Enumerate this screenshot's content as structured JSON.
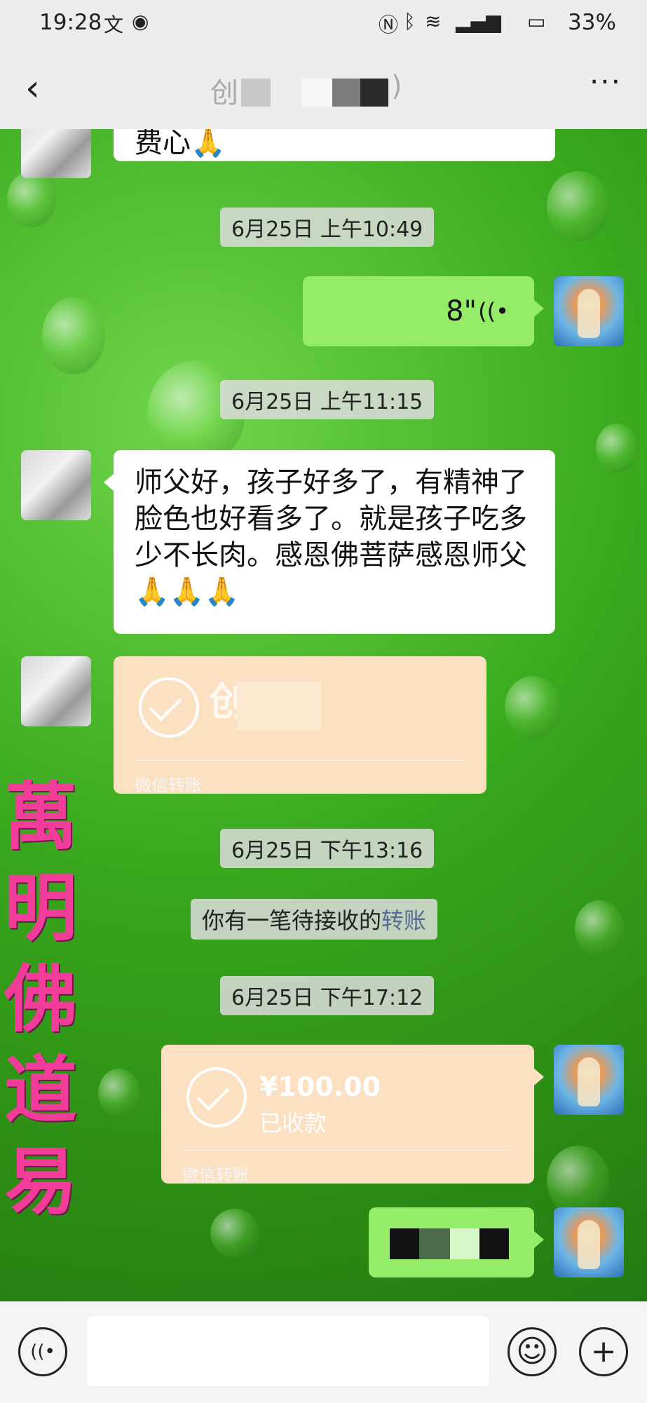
{
  "status_bar": {
    "time": "19:28",
    "battery": "33%",
    "icons": [
      "cn-input-icon",
      "eye-icon",
      "nfc-icon",
      "bluetooth-icon",
      "wifi-icon",
      "signal-icon",
      "battery-icon"
    ]
  },
  "header": {
    "back_glyph": "‹",
    "title_visible": "创",
    "title_suffix": ")",
    "more_glyph": "···"
  },
  "messages": [
    {
      "type": "text",
      "side": "left",
      "text": "费心🙏"
    },
    {
      "type": "time",
      "text": "6月25日 上午10:49"
    },
    {
      "type": "voice",
      "side": "right",
      "duration": "8\"",
      "voice_glyph": "((•"
    },
    {
      "type": "time",
      "text": "6月25日 上午11:15"
    },
    {
      "type": "text",
      "side": "left",
      "text": "师父好，孩子好多了，有精神了脸色也好看多了。就是孩子吃多少不长肉。感恩佛菩萨感恩师父🙏🙏🙏"
    },
    {
      "type": "transfer",
      "side": "left",
      "amount_visible": "创",
      "label": "微信转账"
    },
    {
      "type": "time",
      "text": "6月25日 下午13:16"
    },
    {
      "type": "system",
      "text": "你有一笔待接收的",
      "link": "转账"
    },
    {
      "type": "time",
      "text": "6月25日 下午17:12"
    },
    {
      "type": "transfer",
      "side": "right",
      "amount": "¥100.00",
      "status": "已收款",
      "label": "微信转账"
    },
    {
      "type": "text",
      "side": "right",
      "text": ""
    }
  ],
  "watermark": {
    "text": "萬明佛道易"
  },
  "bottom_bar": {
    "voice_glyph": "((•",
    "emoji_glyph": "☺",
    "plus_glyph": "+"
  },
  "colors": {
    "my_bubble": "#95ec69",
    "their_bubble": "#ffffff",
    "transfer": "#fbe0c2",
    "watermark": "#f23c9a"
  }
}
